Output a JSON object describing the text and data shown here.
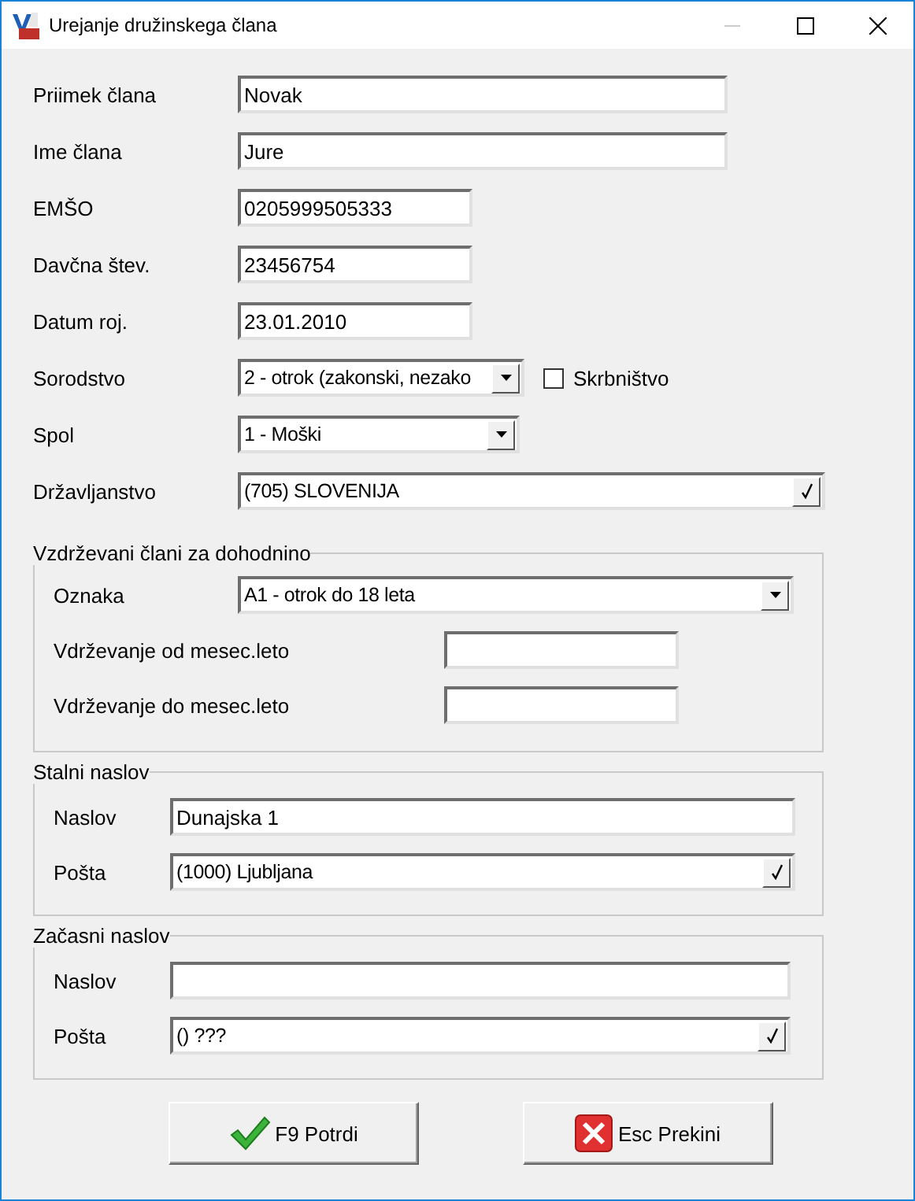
{
  "window": {
    "title": "Urejanje družinskega člana"
  },
  "fields": [
    {
      "kind": "text",
      "label": "Priimek člana",
      "value": "Novak"
    },
    {
      "kind": "text",
      "label": "Ime člana",
      "value": "Jure"
    },
    {
      "kind": "text",
      "label": "EMŠO",
      "value": "0205999505333"
    },
    {
      "kind": "text",
      "label": "Davčna štev.",
      "value": "23456754"
    },
    {
      "kind": "text",
      "label": "Datum roj.",
      "value": "23.01.2010"
    },
    {
      "kind": "combo",
      "label": "Sorodstvo",
      "value": "2 - otrok (zakonski, nezako",
      "checkbox": {
        "label": "Skrbništvo",
        "checked": false
      }
    },
    {
      "kind": "combo",
      "label": "Spol",
      "value": "1 - Moški"
    },
    {
      "kind": "lookup",
      "label": "Državljanstvo",
      "value": "(705) SLOVENIJA"
    }
  ],
  "groups": [
    {
      "legend": "Vzdrževani člani za dohodnino",
      "fields": [
        {
          "kind": "combo",
          "label": "Oznaka",
          "value": "A1 - otrok do 18 leta"
        },
        {
          "kind": "text",
          "label": "Vdrževanje od mesec.leto"
        },
        {
          "kind": "text",
          "label": "Vdrževanje do mesec.leto"
        }
      ]
    },
    {
      "legend": "Stalni naslov",
      "fields": [
        {
          "kind": "text",
          "label": "Naslov",
          "value": "Dunajska 1"
        },
        {
          "kind": "lookup",
          "label": "Pošta",
          "value": "(1000) Ljubljana"
        }
      ]
    },
    {
      "legend": "Začasni naslov",
      "fields": [
        {
          "kind": "text",
          "label": "Naslov"
        },
        {
          "kind": "lookup",
          "label": "Pošta",
          "value": "() ???"
        }
      ]
    }
  ],
  "buttons": [
    {
      "kind": "confirm",
      "label": "F9 Potrdi"
    },
    {
      "kind": "cancel",
      "label": "Esc Prekini"
    }
  ]
}
